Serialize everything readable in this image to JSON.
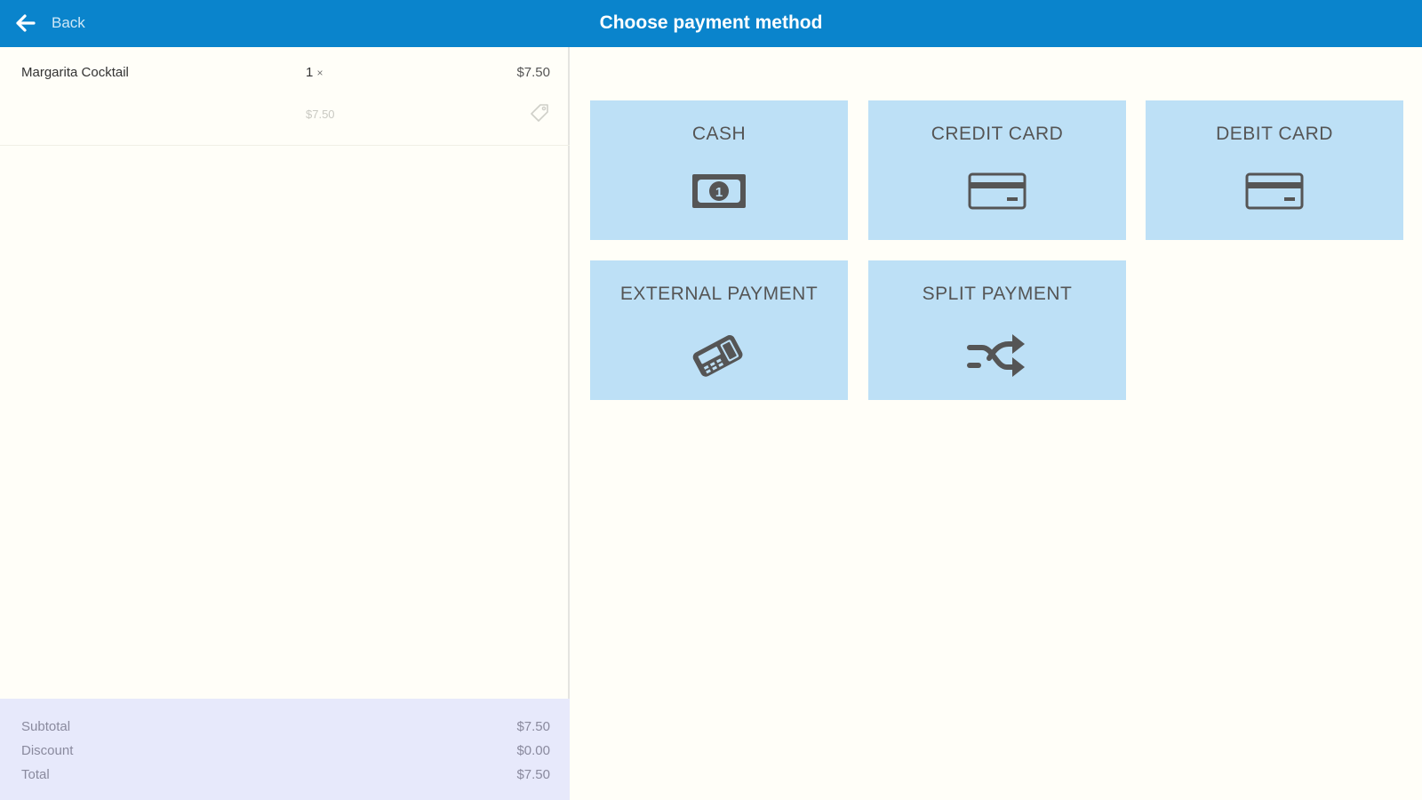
{
  "header": {
    "back_label": "Back",
    "title": "Choose payment method"
  },
  "order": {
    "items": [
      {
        "name": "Margarita Cocktail",
        "qty": "1",
        "qty_suffix": "×",
        "price": "$7.50",
        "unit_price": "$7.50"
      }
    ]
  },
  "totals": {
    "subtotal_label": "Subtotal",
    "subtotal_value": "$7.50",
    "discount_label": "Discount",
    "discount_value": "$0.00",
    "total_label": "Total",
    "total_value": "$7.50"
  },
  "payment_methods": [
    {
      "label": "CASH",
      "icon": "cash-icon"
    },
    {
      "label": "CREDIT CARD",
      "icon": "credit-card-icon"
    },
    {
      "label": "DEBIT CARD",
      "icon": "debit-card-icon"
    },
    {
      "label": "EXTERNAL PAYMENT",
      "icon": "card-terminal-icon"
    },
    {
      "label": "SPLIT PAYMENT",
      "icon": "split-arrows-icon"
    }
  ],
  "colors": {
    "header": "#0a84cc",
    "tile": "#bde0f6",
    "totals_bg": "#e7e9fb",
    "background": "#fffef8"
  }
}
